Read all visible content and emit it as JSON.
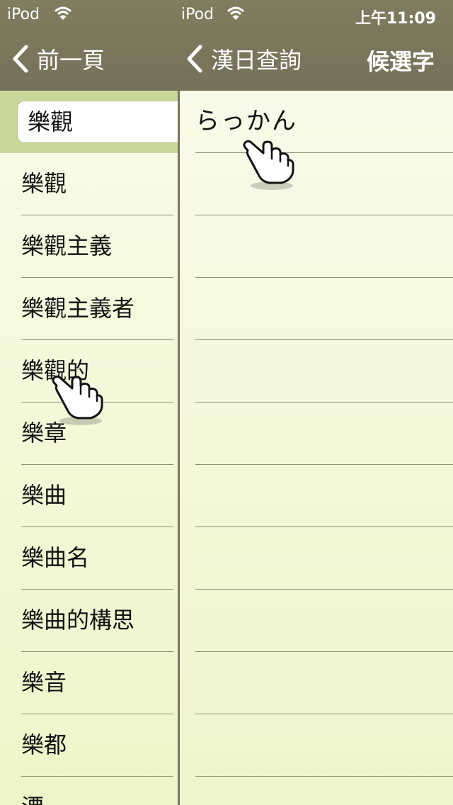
{
  "status_bar": {
    "left_device": "iPod",
    "center_device": "iPod",
    "time": "上午11:09"
  },
  "nav": {
    "back_label": "前一頁",
    "title_back_label": "漢日查詢",
    "right_button": "候選字"
  },
  "search": {
    "value": "樂觀"
  },
  "left_items": [
    "樂觀",
    "樂觀主義",
    "樂觀主義者",
    "樂觀的",
    "樂章",
    "樂曲",
    "樂曲名",
    "樂曲的構思",
    "樂音",
    "樂都",
    "漂"
  ],
  "right_items": [
    "らっかん",
    "",
    "",
    "",
    "",
    "",
    "",
    "",
    "",
    "",
    "",
    ""
  ],
  "icons": [
    "wifi-icon",
    "chevron-left-icon",
    "pointing-hand-icon"
  ]
}
